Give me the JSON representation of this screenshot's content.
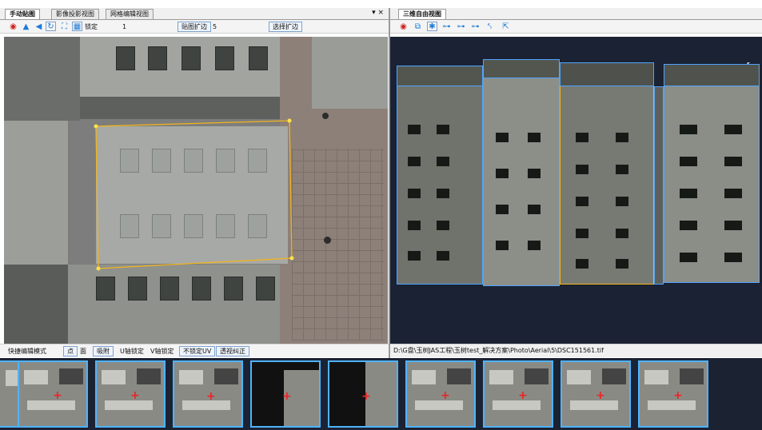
{
  "left_panel": {
    "tabs": [
      "手动贴图",
      "影像投影视图",
      "网格编辑视图"
    ],
    "close_glyph": "▾ ×",
    "toolbar": {
      "lock_label": "锁定",
      "lock_value": "1",
      "expand_label": "贴图扩边",
      "expand_value": "5",
      "select_expand_button": "选择扩边"
    },
    "bottom_toolbar": {
      "mode_label": "快捷编辑模式",
      "point_button": "点",
      "face_button": "面",
      "snap_button": "吸附",
      "u_lock": "U轴锁定",
      "v_lock": "V轴锁定",
      "unlock_uv": "不锁定UV",
      "perspective_fix": "透视纠正"
    }
  },
  "right_panel": {
    "tabs": [
      "三维自由视图"
    ],
    "status_path": "D:\\G盘\\玉树JAS工程\\玉树test_解决方案\\Photo\\Aerial\\5\\DSC151561.tif"
  },
  "icons": [
    "camera-icon",
    "flip-icon",
    "mirror-icon",
    "rotate-icon",
    "fit-icon",
    "grid-icon",
    "sun-icon",
    "toggle-icon",
    "cursor-icon"
  ],
  "colors": {
    "selection": "#f2b51c",
    "wire": "#4fa4ff",
    "view_bg": "#1a2233"
  }
}
